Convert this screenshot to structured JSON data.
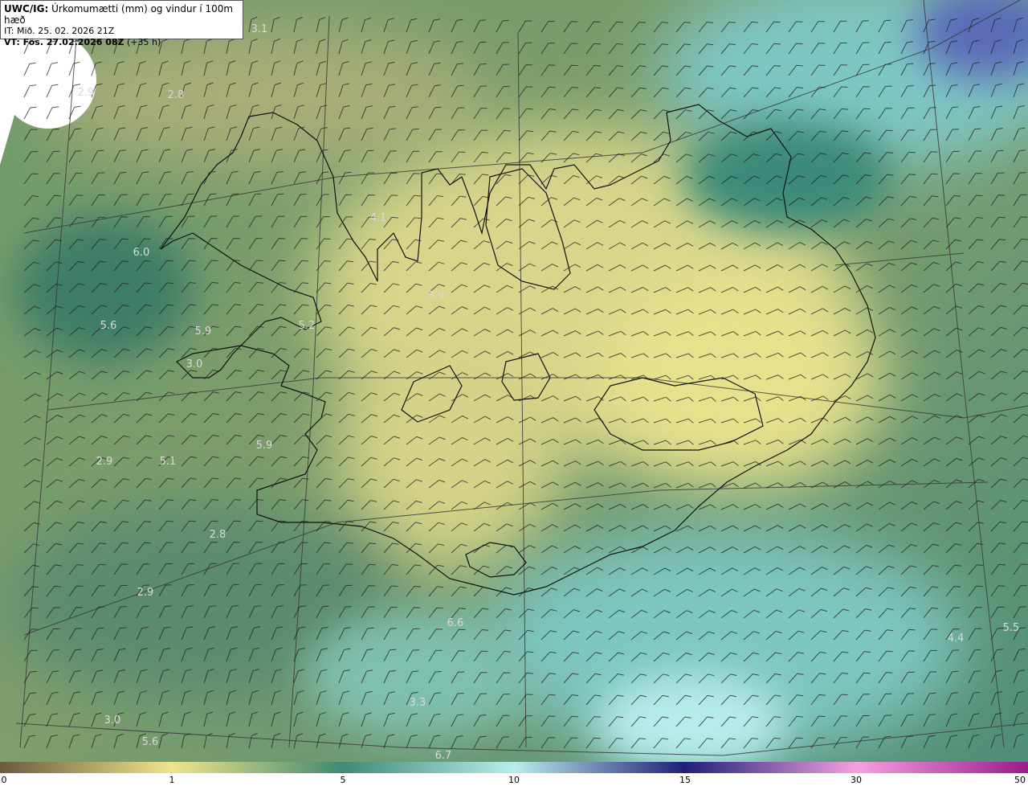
{
  "header": {
    "model": "UWC/IG:",
    "title": "Úrkomumætti (mm) og vindur í 100m hæð",
    "issue": "IT: Mið. 25. 02. 2026 21Z",
    "valid_label": "VT: Fös. 27.02.2026 08Z",
    "valid_offset": "(+35 h)"
  },
  "colorbar": {
    "ticks": [
      "0",
      "1",
      "5",
      "10",
      "15",
      "30",
      "50"
    ],
    "colors": [
      "#6b5a3e",
      "#f0e48a",
      "#3f8a72",
      "#b8ecec",
      "#1f1f7a",
      "#f5a0e0",
      "#9c1a8c"
    ]
  },
  "labels": [
    {
      "text": "3.1"
    },
    {
      "text": "2.9"
    },
    {
      "text": "2.8"
    },
    {
      "text": "4.1"
    },
    {
      "text": "6.0"
    },
    {
      "text": "3.9"
    },
    {
      "text": "5.6"
    },
    {
      "text": "5.9"
    },
    {
      "text": "5.2"
    },
    {
      "text": "3.0"
    },
    {
      "text": "5.9"
    },
    {
      "text": "2.9"
    },
    {
      "text": "5.1"
    },
    {
      "text": "2.8"
    },
    {
      "text": "2.9"
    },
    {
      "text": "6.6"
    },
    {
      "text": "4.4"
    },
    {
      "text": "5.5"
    },
    {
      "text": "3.3"
    },
    {
      "text": "3.0"
    },
    {
      "text": "5.6"
    },
    {
      "text": "6.7"
    }
  ]
}
